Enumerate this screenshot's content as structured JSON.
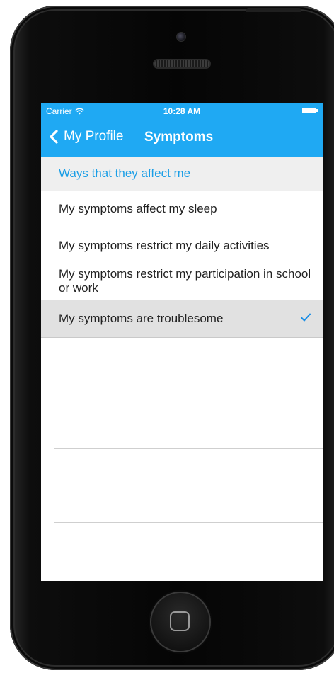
{
  "status_bar": {
    "carrier": "Carrier",
    "time": "10:28 AM",
    "wifi_icon": "wifi-icon",
    "battery_icon": "battery-icon"
  },
  "nav": {
    "back_label": "My Profile",
    "back_icon": "chevron-left-icon",
    "title": "Symptoms",
    "color": "#1fa9f3"
  },
  "section": {
    "header": "Ways that they affect me",
    "header_color": "#1a9ee6"
  },
  "rows": [
    {
      "label": "My symptoms affect my sleep",
      "selected": false
    },
    {
      "label": "My symptoms restrict my daily activities",
      "selected": false
    },
    {
      "label": "My symptoms restrict my participation in school or work",
      "selected": false
    },
    {
      "label": "My symptoms are troublesome",
      "selected": true,
      "accessory": "checkmark-icon"
    }
  ]
}
